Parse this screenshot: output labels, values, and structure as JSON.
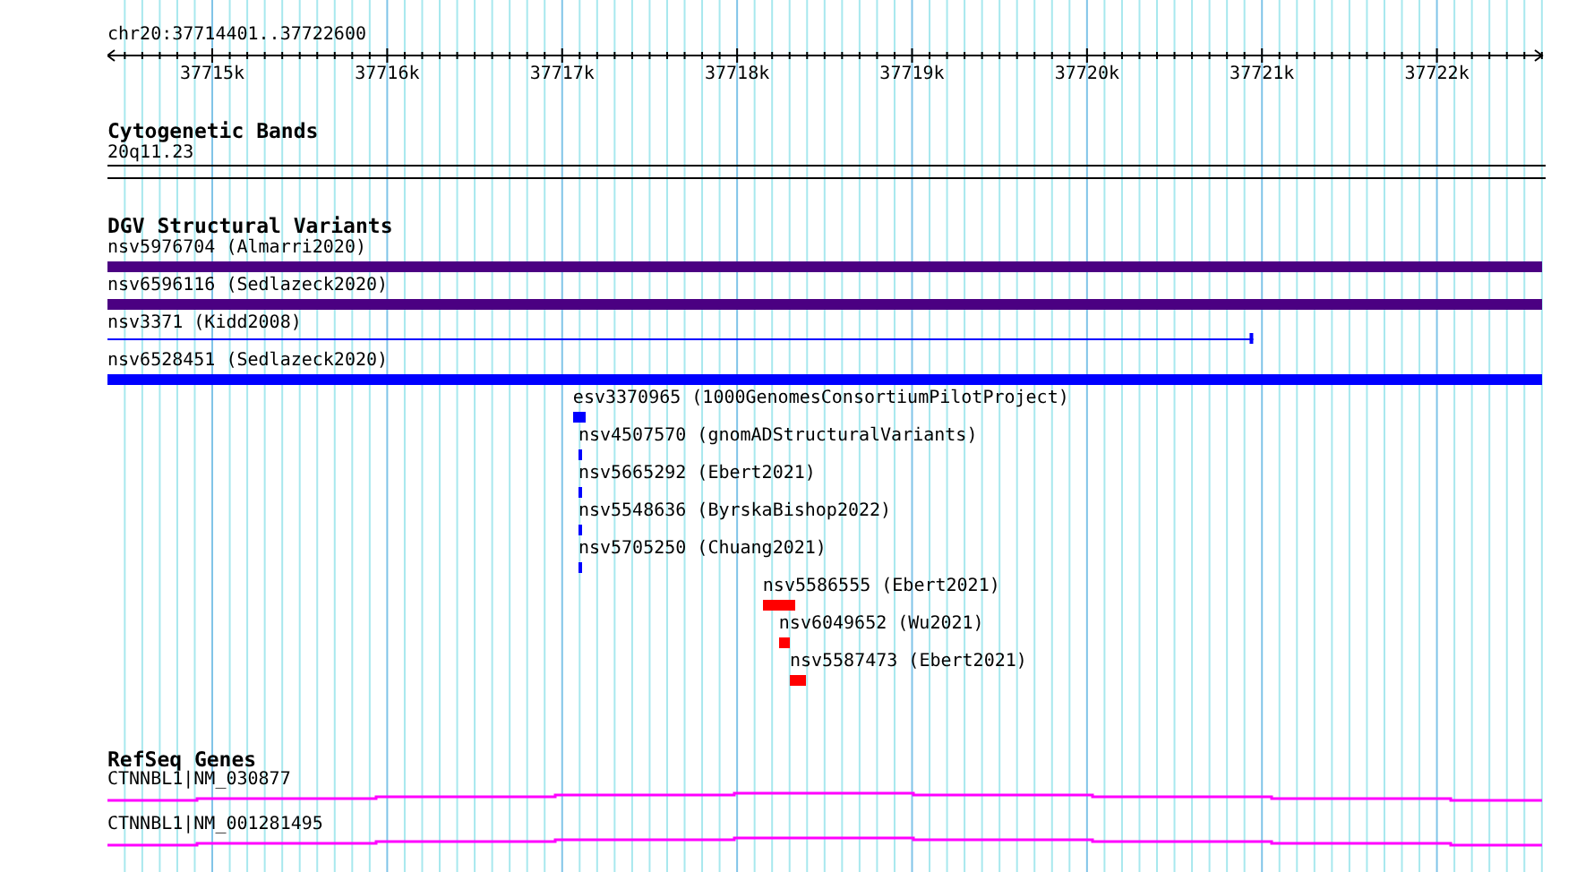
{
  "ruler": {
    "region": "chr20:37714401..37722600",
    "ticks": [
      "37715k",
      "37716k",
      "37717k",
      "37718k",
      "37719k",
      "37720k",
      "37721k",
      "37722k"
    ]
  },
  "tracks": [
    {
      "kind": "bands",
      "title": "Cytogenetic Bands",
      "features": [
        {
          "label": "20q11.23"
        }
      ]
    },
    {
      "kind": "variants",
      "title": "DGV Structural Variants",
      "features": [
        {
          "label": "nsv5976704 (Almarri2020)",
          "kind": "bar",
          "color": "#4b0082"
        },
        {
          "label": "nsv6596116 (Sedlazeck2020)",
          "kind": "bar",
          "color": "#4b0082"
        },
        {
          "label": "nsv3371 (Kidd2008)",
          "kind": "line",
          "color": "#0000ff"
        },
        {
          "label": "nsv6528451 (Sedlazeck2020)",
          "kind": "bar",
          "color": "#0000ff"
        },
        {
          "label": "esv3370965 (1000GenomesConsortiumPilotProject)",
          "kind": "bar",
          "color": "#0000ff"
        },
        {
          "label": "nsv4507570 (gnomADStructuralVariants)",
          "kind": "bar",
          "color": "#0000ff"
        },
        {
          "label": "nsv5665292 (Ebert2021)",
          "kind": "bar",
          "color": "#0000ff"
        },
        {
          "label": "nsv5548636 (ByrskaBishop2022)",
          "kind": "bar",
          "color": "#0000ff"
        },
        {
          "label": "nsv5705250 (Chuang2021)",
          "kind": "bar",
          "color": "#0000ff"
        },
        {
          "label": "nsv5586555 (Ebert2021)",
          "kind": "bar",
          "color": "#ff0000"
        },
        {
          "label": "nsv6049652 (Wu2021)",
          "kind": "bar",
          "color": "#ff0000"
        },
        {
          "label": "nsv5587473 (Ebert2021)",
          "kind": "bar",
          "color": "#ff0000"
        }
      ]
    },
    {
      "kind": "genes",
      "title": "RefSeq Genes",
      "features": [
        {
          "label": "CTNNBL1|NM_030877"
        },
        {
          "label": "CTNNBL1|NM_001281495"
        }
      ]
    }
  ]
}
